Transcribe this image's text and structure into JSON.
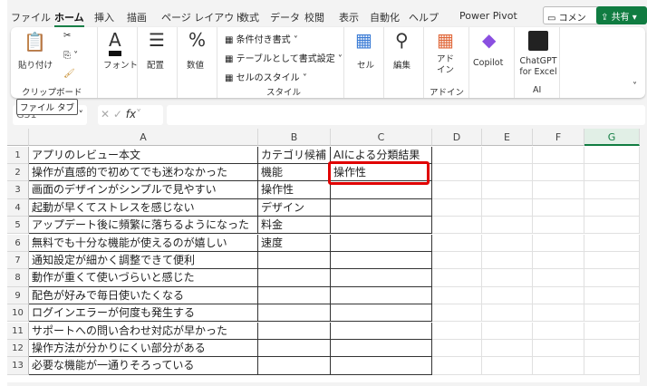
{
  "menu_tabs": [
    "ファイル",
    "ホーム",
    "挿入",
    "描画",
    "ページ レイアウト",
    "数式",
    "データ",
    "校閲",
    "表示",
    "自動化",
    "ヘルプ",
    "Power Pivot"
  ],
  "active_tab": "ホーム",
  "comment_label": "コメント",
  "share_label": "共有",
  "ribbon": {
    "paste": "貼り付け",
    "clipboard": "クリップボード",
    "font": "フォント",
    "alignment": "配置",
    "number": "数値",
    "conditional": "条件付き書式",
    "table": "テーブルとして書式設定",
    "cell_style": "セルのスタイル",
    "styles": "スタイル",
    "cells": "セル",
    "edit": "編集",
    "addin": "アド\nイン",
    "addin_group": "アドイン",
    "copilot": "Copilot",
    "chatgpt": "ChatGPT for Excel",
    "ai": "AI"
  },
  "tooltip": "ファイル タブ",
  "name_box": "G31",
  "fx": "fx",
  "columns": [
    "A",
    "B",
    "C",
    "D",
    "E",
    "F",
    "G"
  ],
  "selected_column": "G",
  "rows": [
    [
      "アプリのレビュー本文",
      "カテゴリ候補",
      "AIによる分類結果"
    ],
    [
      "操作が直感的で初めてでも迷わなかった",
      "機能",
      "操作性"
    ],
    [
      "画面のデザインがシンプルで見やすい",
      "操作性",
      ""
    ],
    [
      "起動が早くてストレスを感じない",
      "デザイン",
      ""
    ],
    [
      "アップデート後に頻繁に落ちるようになった",
      "料金",
      ""
    ],
    [
      "無料でも十分な機能が使えるのが嬉しい",
      "速度",
      ""
    ],
    [
      "通知設定が細かく調整できて便利",
      "",
      ""
    ],
    [
      "動作が重くて使いづらいと感じた",
      "",
      ""
    ],
    [
      "配色が好みで毎日使いたくなる",
      "",
      ""
    ],
    [
      "ログインエラーが何度も発生する",
      "",
      ""
    ],
    [
      "サポートへの問い合わせ対応が早かった",
      "",
      ""
    ],
    [
      "操作方法が分かりにくい部分がある",
      "",
      ""
    ],
    [
      "必要な機能が一通りそろっている",
      "",
      ""
    ]
  ],
  "highlight_color": "#e00000",
  "accent": "#107c41"
}
